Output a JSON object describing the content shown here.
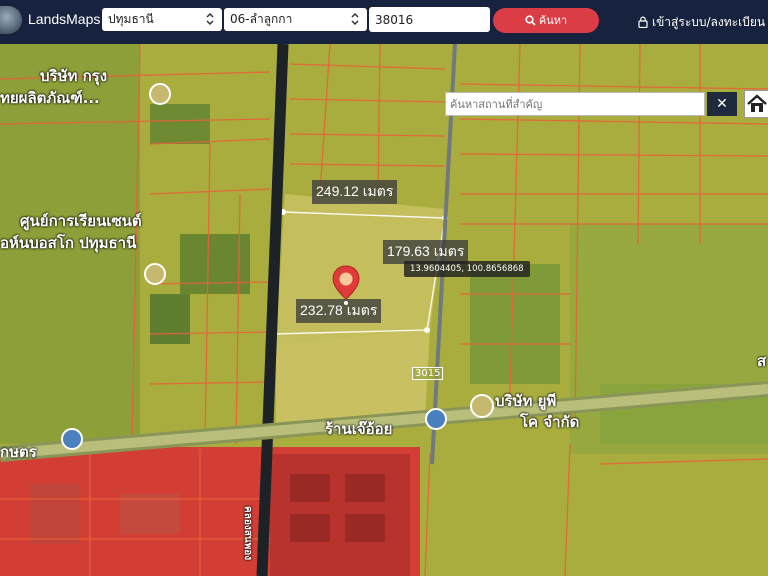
{
  "header": {
    "brand": "LandsMaps",
    "province": "ปทุมธานี",
    "district": "06-ลำลูกกา",
    "parcel_number": "38016",
    "search_label": "ค้นหา",
    "login_label": "เข้าสู่ระบบ/ลงทะเบียน"
  },
  "map": {
    "place_search_placeholder": "ค้นหาสถานที่สำคัญ",
    "clear_label": "✕",
    "distance_labels": {
      "top": "249.12 เมตร",
      "right": "179.63 เมตร",
      "bottom": "232.78 เมตร"
    },
    "coordinates": "13.9604405, 100.8656868",
    "place_labels": {
      "company_top_1": "บริษัท กรุง",
      "company_top_2": "ทยผลิตภัณฑ์...",
      "learning_center_1": "ศูนย์การเรียนเซนต์",
      "learning_center_2": "อห์นบอสโก ปทุมธานี",
      "company_right_1": "บริษัท ยูพี",
      "company_right_2": "โค จำกัด",
      "shop": "ร้านเจ๊อ้อย",
      "bottom_left": "กษตร",
      "road_vertical": "คลองสนพอง",
      "edge_right": "ส"
    },
    "road_number": "3015",
    "colors": {
      "header_bg": "#17233e",
      "search_button": "#dc3c45",
      "pin": "#e03a3a",
      "parcel_lines": "#e8623a",
      "yellow_zone": "#c9c24a",
      "red_zone": "#d63a34"
    }
  }
}
